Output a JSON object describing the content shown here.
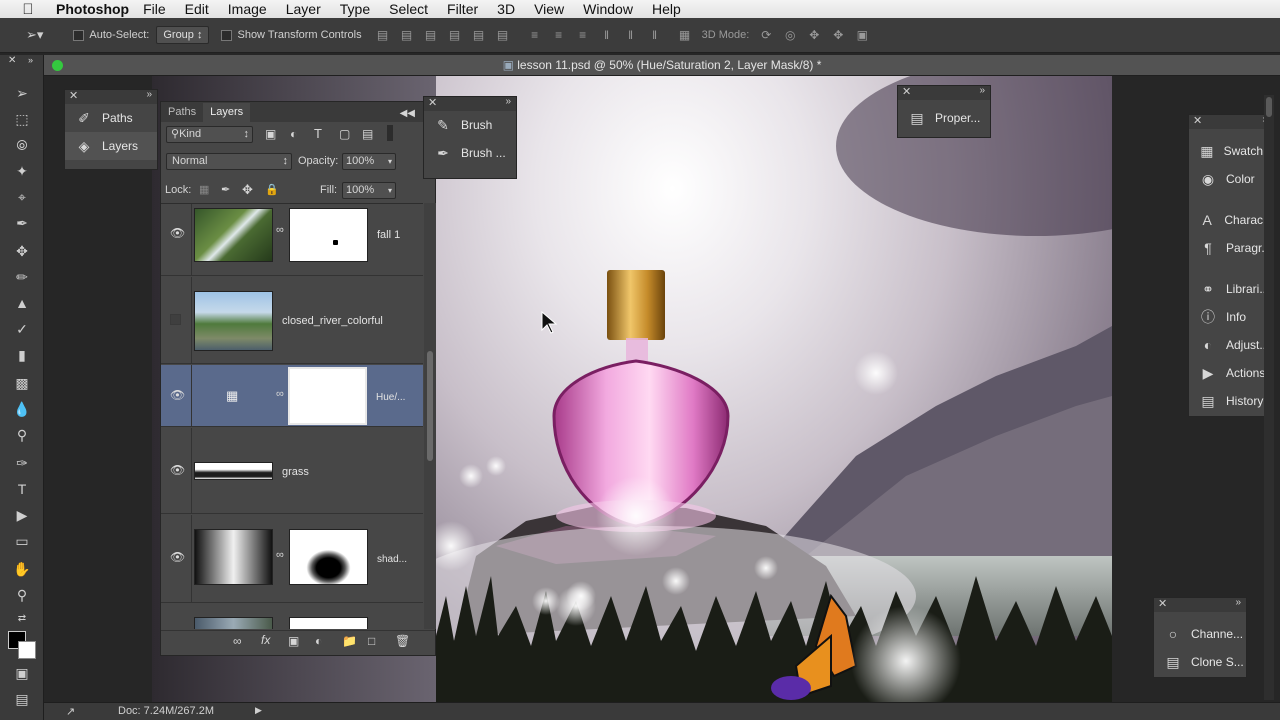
{
  "menubar": {
    "app": "Photoshop",
    "items": [
      "File",
      "Edit",
      "Image",
      "Layer",
      "Type",
      "Select",
      "Filter",
      "3D",
      "View",
      "Window",
      "Help"
    ]
  },
  "options": {
    "auto_select_label": "Auto-Select:",
    "auto_select_value": "Group",
    "show_transform_label": "Show Transform Controls",
    "mode_3d_label": "3D Mode:"
  },
  "document": {
    "title": "lesson 11.psd @ 50% (Hue/Saturation 2, Layer Mask/8) *"
  },
  "left_panel": {
    "items": [
      {
        "label": "Paths",
        "icon": "paths-icon"
      },
      {
        "label": "Layers",
        "icon": "layers-icon"
      }
    ]
  },
  "brush_panel": {
    "items": [
      {
        "label": "Brush",
        "icon": "brush-icon"
      },
      {
        "label": "Brush ...",
        "icon": "brush-presets-icon"
      }
    ]
  },
  "properties_panel": {
    "label": "Proper..."
  },
  "layers_panel": {
    "tabs": [
      "Paths",
      "Layers"
    ],
    "kind_label": "Kind",
    "blend_mode": "Normal",
    "opacity_label": "Opacity:",
    "opacity_value": "100%",
    "lock_label": "Lock:",
    "fill_label": "Fill:",
    "fill_value": "100%",
    "layers": [
      {
        "name": "fall 1",
        "visible": true
      },
      {
        "name": "closed_river_colorful",
        "visible": false
      },
      {
        "name": "Hue/...",
        "visible": true,
        "selected": true
      },
      {
        "name": "grass",
        "visible": true
      },
      {
        "name": "shad...",
        "visible": true
      }
    ]
  },
  "right_panel_top": {
    "items": [
      {
        "label": "Swatch...",
        "icon": "swatches-icon"
      },
      {
        "label": "Color",
        "icon": "color-icon"
      },
      {
        "label": "Charac...",
        "icon": "character-icon"
      },
      {
        "label": "Paragr...",
        "icon": "paragraph-icon"
      },
      {
        "label": "Librari...",
        "icon": "libraries-icon"
      },
      {
        "label": "Info",
        "icon": "info-icon"
      },
      {
        "label": "Adjust...",
        "icon": "adjustments-icon"
      },
      {
        "label": "Actions",
        "icon": "actions-icon"
      },
      {
        "label": "History",
        "icon": "history-icon"
      }
    ]
  },
  "right_panel_bottom": {
    "items": [
      {
        "label": "Channe...",
        "icon": "channels-icon"
      },
      {
        "label": "Clone S...",
        "icon": "clone-source-icon"
      }
    ]
  },
  "status": {
    "doc_info": "Doc: 7.24M/267.2M"
  },
  "colors": {
    "accent_selected_row": "#5a6a8c",
    "green_window_button": "#34c93f"
  }
}
